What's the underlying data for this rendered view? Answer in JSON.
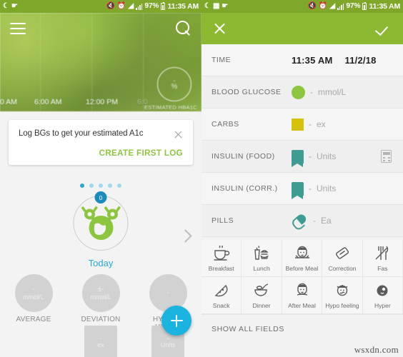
{
  "status_bar": {
    "left_icons": [
      "moon-icon",
      "screenshot-icon",
      "app-icon"
    ],
    "right_icons": [
      "mute-icon",
      "alarm-icon",
      "wifi-icon",
      "signal-icon"
    ],
    "battery": "97%",
    "time": "11:35 AM"
  },
  "left_screen": {
    "appbar": {
      "menu": "menu-icon",
      "search": "search-icon"
    },
    "chart": {
      "axis_labels": [
        "0 AM",
        "6:00 AM",
        "12:00 PM",
        "6:0"
      ],
      "hba1c_value": "-",
      "hba1c_percent": "%",
      "hba1c_label": "ESTIMATED HBA1C"
    },
    "toast": {
      "message": "Log BGs to get your estimated A1c",
      "action": "CREATE FIRST LOG",
      "close": "close-icon"
    },
    "carousel": {
      "dots": 5,
      "active_dot": 0,
      "badge_count": "0",
      "day_label": "Today",
      "next": "chevron-right-icon"
    },
    "stats": [
      {
        "top": "-",
        "unit": "mmol/L",
        "name": "AVERAGE"
      },
      {
        "top": "±-",
        "unit": "mmol/L",
        "name": "DEVIATION"
      },
      {
        "top": "-",
        "unit": "",
        "name": "HYPERS\nHYPOS"
      }
    ],
    "tiles": [
      {
        "dash": "-",
        "unit": "ex"
      },
      {
        "dash": "-",
        "unit": "Units"
      }
    ],
    "fab": "add-icon"
  },
  "right_screen": {
    "appbar": {
      "close": "close-icon",
      "confirm": "check-icon"
    },
    "fields": [
      {
        "label": "TIME",
        "time": "11:35 AM",
        "date": "11/2/18",
        "swatch": "none",
        "dash": "",
        "unit": "",
        "extra": ""
      },
      {
        "label": "BLOOD GLUCOSE",
        "swatch": "circle",
        "dash": "-",
        "unit": "mmol/L",
        "extra": ""
      },
      {
        "label": "CARBS",
        "swatch": "square",
        "dash": "-",
        "unit": "ex",
        "extra": ""
      },
      {
        "label": "INSULIN (FOOD)",
        "swatch": "pen",
        "dash": "-",
        "unit": "Units",
        "extra": "calculator-icon"
      },
      {
        "label": "INSULIN (CORR.)",
        "swatch": "pen",
        "dash": "-",
        "unit": "Units",
        "extra": ""
      },
      {
        "label": "PILLS",
        "swatch": "pill",
        "dash": "-",
        "unit": "Ea",
        "extra": ""
      }
    ],
    "tag_rows": [
      [
        {
          "icon": "coffee-cup-icon",
          "label": "Breakfast"
        },
        {
          "icon": "burger-drink-icon",
          "label": "Lunch"
        },
        {
          "icon": "face-before-meal-icon",
          "label": "Before Meal"
        },
        {
          "icon": "syringe-icon",
          "label": "Correction"
        },
        {
          "icon": "fork-knife-icon",
          "label": "Fas"
        }
      ],
      [
        {
          "icon": "pizza-slice-icon",
          "label": "Snack"
        },
        {
          "icon": "bowl-icon",
          "label": "Dinner"
        },
        {
          "icon": "face-after-meal-icon",
          "label": "After Meal"
        },
        {
          "icon": "face-hypo-icon",
          "label": "Hypo feeling"
        },
        {
          "icon": "face-hyper-icon",
          "label": "Hyper"
        }
      ]
    ],
    "show_all": "SHOW ALL FIELDS",
    "watermark": "wsxdn.com"
  },
  "colors": {
    "status_bar_green": "#7fa82b",
    "appbar_green": "#8cb832",
    "accent_green": "#8cc63e",
    "accent_cyan": "#29a8d8",
    "carbs_yellow": "#d6c20a",
    "insulin_teal": "#3f9c93"
  }
}
